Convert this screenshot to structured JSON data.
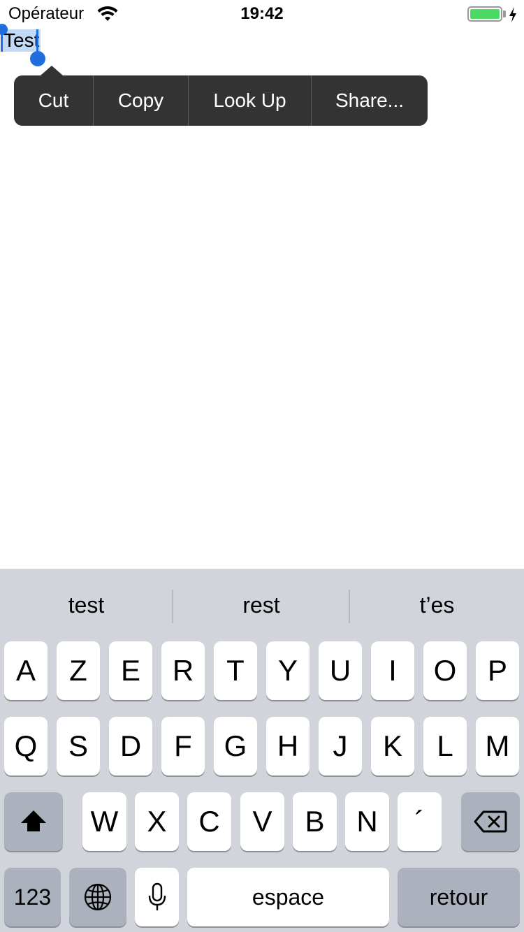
{
  "status_bar": {
    "carrier": "Opérateur",
    "time": "19:42",
    "battery_level": 1.0,
    "battery_color": "#4cd964",
    "icons": [
      "wifi-icon",
      "battery-icon",
      "charging-icon"
    ]
  },
  "editor": {
    "text": "Test",
    "selection_color": "#c2d9f5",
    "handle_color": "#1f6ee0"
  },
  "edit_menu": {
    "items": [
      "Cut",
      "Copy",
      "Look Up",
      "Share..."
    ],
    "background": "#333333"
  },
  "keyboard": {
    "predictions": [
      "test",
      "rest",
      "t’es"
    ],
    "row1": [
      "A",
      "Z",
      "E",
      "R",
      "T",
      "Y",
      "U",
      "I",
      "O",
      "P"
    ],
    "row2": [
      "Q",
      "S",
      "D",
      "F",
      "G",
      "H",
      "J",
      "K",
      "L",
      "M"
    ],
    "row3": [
      "W",
      "X",
      "C",
      "V",
      "B",
      "N",
      "´"
    ],
    "numbers_label": "123",
    "space_label": "espace",
    "return_label": "retour",
    "icons": [
      "shift-icon",
      "backspace-icon",
      "globe-icon",
      "microphone-icon"
    ]
  }
}
